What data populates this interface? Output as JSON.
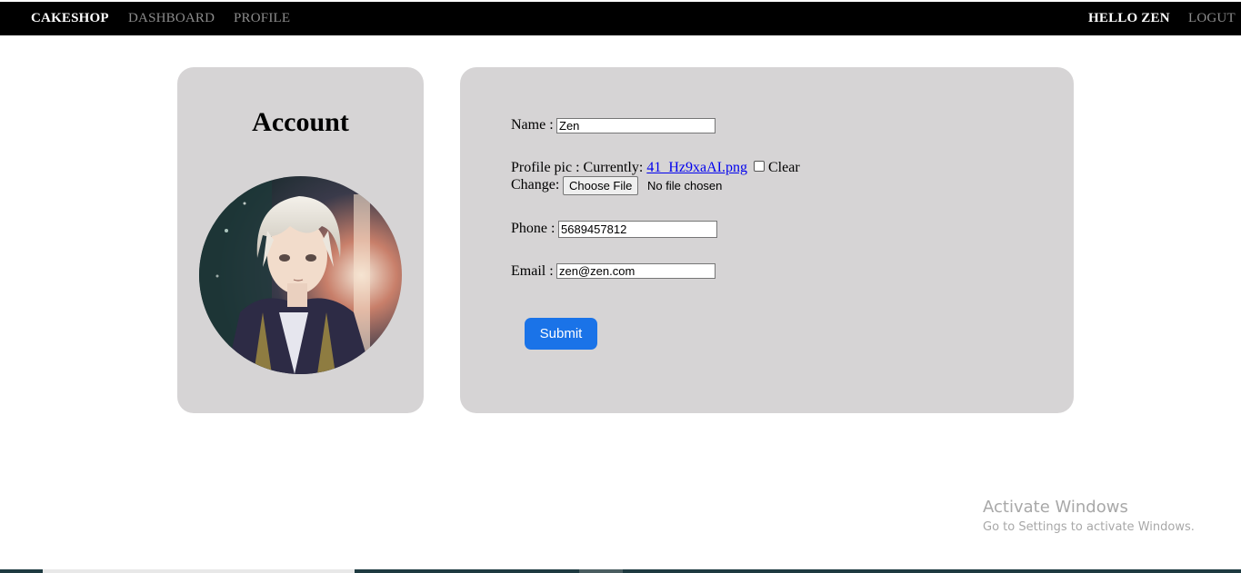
{
  "navbar": {
    "brand": "CAKESHOP",
    "links": [
      "DASHBOARD",
      "PROFILE"
    ],
    "greeting": "HELLO ZEN",
    "logout": "LOGUT"
  },
  "account": {
    "title": "Account"
  },
  "form": {
    "name_label": "Name :",
    "name_value": "Zen",
    "profile_pic_label": "Profile pic : Currently:",
    "profile_pic_file": "41_Hz9xaAI.png",
    "clear_label": "Clear",
    "change_label": "Change:",
    "choose_file_label": "Choose File",
    "no_file_text": "No file chosen",
    "phone_label": "Phone :",
    "phone_value": "5689457812",
    "email_label": "Email :",
    "email_value": "zen@zen.com",
    "submit_label": "Submit"
  },
  "watermark": {
    "title": "Activate Windows",
    "subtitle": "Go to Settings to activate Windows."
  },
  "colors": {
    "navbar_bg": "#000000",
    "card_bg": "#d6d4d5",
    "submit_bg": "#1a73e8",
    "link": "#0000ee"
  }
}
